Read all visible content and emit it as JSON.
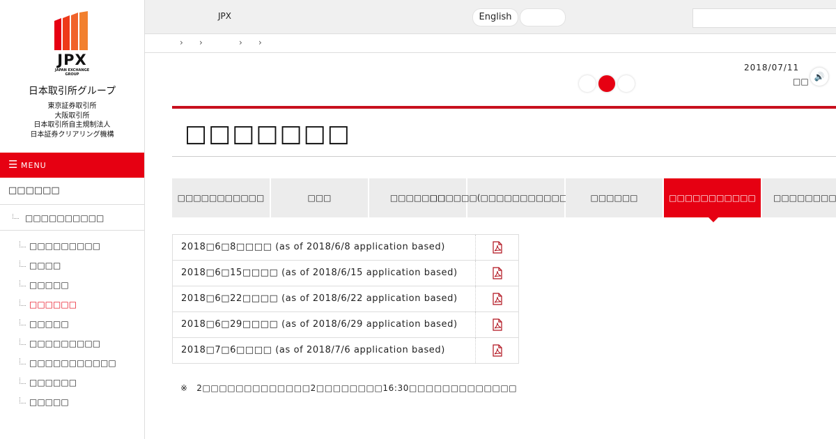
{
  "brand": {
    "logo_text": "JPX",
    "logo_sub": [
      "JAPAN EXCHANGE",
      "GROUP"
    ],
    "group_name": "日本取引所グループ",
    "subsidiaries": [
      "東京証券取引所",
      "大阪取引所",
      "日本取引所自主規制法人",
      "日本証券クリアリング機構"
    ],
    "accent_color": "#e60012"
  },
  "menu": {
    "label": "MENU",
    "icon": "hamburger-icon"
  },
  "sidebar": {
    "title": "□□□□□□",
    "sub_item": "□□□□□□□□□□",
    "items": [
      {
        "label": "□□□□□□□□□",
        "active": false
      },
      {
        "label": "□□□□",
        "active": false
      },
      {
        "label": "□□□□□",
        "active": false
      },
      {
        "label": "□□□□□□",
        "active": true
      },
      {
        "label": "□□□□□",
        "active": false
      },
      {
        "label": "□□□□□□□□□",
        "active": false
      },
      {
        "label": "□□□□□□□□□□□",
        "active": false
      },
      {
        "label": "□□□□□□",
        "active": false
      },
      {
        "label": "□□□□□",
        "active": false
      }
    ]
  },
  "topbar": {
    "jpx_label": "JPX",
    "english_label": "English",
    "blank_label": "",
    "search_placeholder": ""
  },
  "breadcrumb": [
    "›",
    "›",
    "›",
    "›"
  ],
  "date": "2018/07/11",
  "date_sub": "□□",
  "speaker_icon": "speaker-icon",
  "page_title": "□□□□□□□",
  "tabs": [
    {
      "label": "□□□□□□□□□□□",
      "active": false
    },
    {
      "label": "□□□",
      "active": false
    },
    {
      "label": "□□□□□□□",
      "active": false
    },
    {
      "label": "□□□□□□(□□□□□□□□□□□□□□□)",
      "active": false
    },
    {
      "label": "□□□□□□",
      "active": false
    },
    {
      "label": "□□□□□□□□□□□",
      "active": true
    },
    {
      "label": "□□□□□□□□□□",
      "active": false
    }
  ],
  "rows": [
    {
      "text": "2018□6□8□□□□ (as of 2018/6/8 application based)",
      "icon": "pdf-icon"
    },
    {
      "text": "2018□6□15□□□□ (as of 2018/6/15 application based)",
      "icon": "pdf-icon"
    },
    {
      "text": "2018□6□22□□□□ (as of 2018/6/22 application based)",
      "icon": "pdf-icon"
    },
    {
      "text": "2018□6□29□□□□ (as of 2018/6/29 application based)",
      "icon": "pdf-icon"
    },
    {
      "text": "2018□7□6□□□□ (as of 2018/7/6 application based)",
      "icon": "pdf-icon"
    }
  ],
  "note": "※　2□□□□□□□□□□□□□2□□□□□□□□16:30□□□□□□□□□□□□□"
}
